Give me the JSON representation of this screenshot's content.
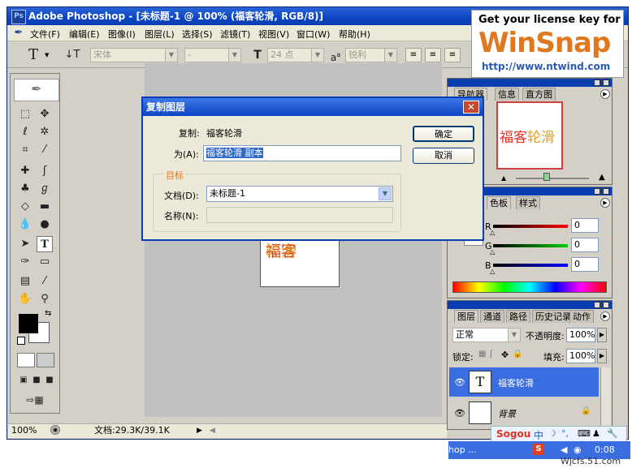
{
  "window": {
    "title": "Adobe Photoshop - [未标题-1 @ 100% (福客轮滑, RGB/8)]",
    "icon": "photoshop-icon"
  },
  "menu": [
    "文件(F)",
    "编辑(E)",
    "图像(I)",
    "图层(L)",
    "选择(S)",
    "滤镜(T)",
    "视图(V)",
    "窗口(W)",
    "帮助(H)"
  ],
  "options": {
    "tool_glyph": "T",
    "font_family": "宋体",
    "font_style": "-",
    "font_size_icon": "T",
    "font_size": "24 点",
    "aa_label": "a",
    "aa_value": "锐利"
  },
  "ad": {
    "line1": "Get your license key for",
    "brand": "WinSnap",
    "url": "http://www.ntwind.com"
  },
  "document": {
    "text_part1": "福客",
    "text_part2": "轮滑"
  },
  "dialog": {
    "title": "复制图层",
    "copy_label": "复制:",
    "copy_value": "福客轮滑",
    "as_label": "为(A):",
    "as_value": "福客轮滑 副本",
    "ok": "确定",
    "cancel": "取消",
    "group_title": "目标",
    "doc_label": "文档(D):",
    "doc_value": "未标题-1",
    "name_label": "名称(N):"
  },
  "navigator": {
    "tabs": [
      "导航器",
      "信息",
      "直方图"
    ],
    "preview_part1": "福客",
    "preview_part2": "轮滑"
  },
  "color": {
    "tabs": [
      "色板",
      "样式"
    ],
    "r_label": "R",
    "g_label": "G",
    "b_label": "B",
    "r": "0",
    "g": "0",
    "b": "0"
  },
  "layers": {
    "tabs": [
      "图层",
      "通道",
      "路径",
      "历史记录",
      "动作"
    ],
    "blend": "正常",
    "opacity_label": "不透明度:",
    "opacity": "100%",
    "lock_label": "锁定:",
    "fill_label": "填充:",
    "fill": "100%",
    "rows": [
      {
        "thumb": "T",
        "name": "福客轮滑"
      },
      {
        "thumb": "",
        "name": "背景"
      }
    ]
  },
  "status": {
    "zoom": "100%",
    "doc": "文档:29.3K/39.1K"
  },
  "ime": {
    "brand": "Sogou",
    "mode": "中"
  },
  "taskbar": {
    "item": "hop ...",
    "time": "0:08"
  },
  "watermark": "Wjcfs.51.com",
  "colors": {
    "title_blue": "#0b45c4",
    "canvas_gray": "#c0c0c0",
    "text_red": "#e0322a",
    "text_blue": "#2a8ad8",
    "text_orange": "#e0a020",
    "layer_selected": "#3a6ee0"
  }
}
